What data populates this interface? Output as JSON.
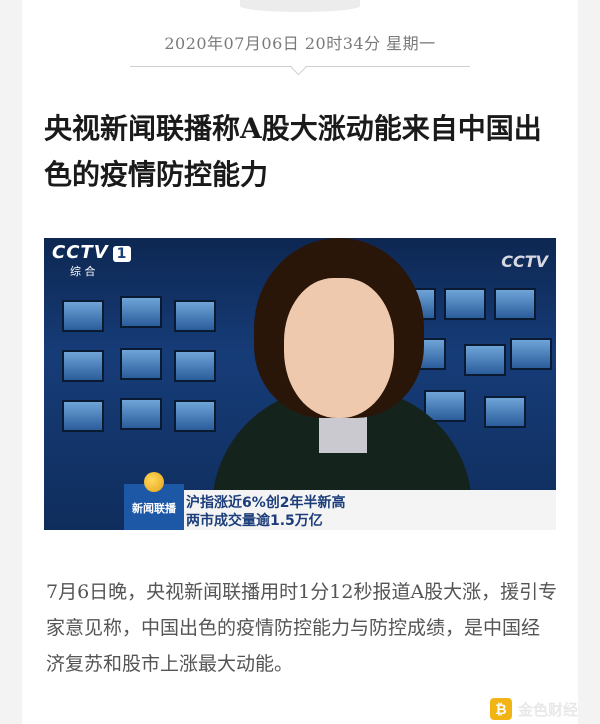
{
  "article": {
    "datetime": "2020年07月06日  20时34分  星期一",
    "title": "央视新闻联播称A股大涨动能来自中国出色的疫情防控能力",
    "body": "7月6日晚，央视新闻联播用时1分12秒报道A股大涨，援引专家意见称，中国出色的疫情防控能力与防控成绩，是中国经济复苏和股市上涨最大动能。"
  },
  "image": {
    "channel_logo": "CCTV",
    "channel_number": "1",
    "channel_sub": "综 合",
    "channel_logo_right": "CCTV",
    "program_logo": "新闻联播",
    "ticker_line1": "沪指涨近6%创2年半新高",
    "ticker_line2": "两市成交量逾1.5万亿"
  },
  "watermark": {
    "icon": "coin-badge-icon",
    "text": "金色财经"
  }
}
